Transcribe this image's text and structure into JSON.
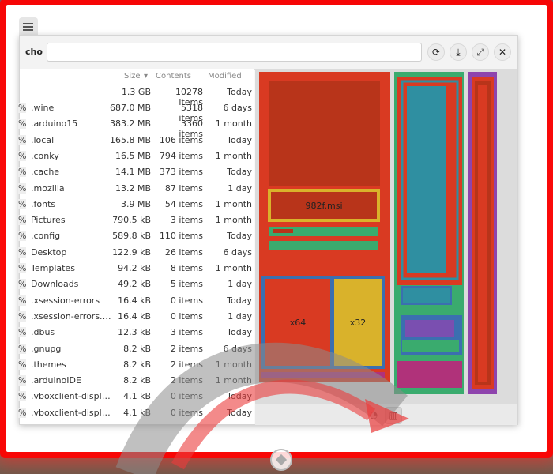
{
  "toolbar": {
    "path_label": "cho",
    "path_value": "",
    "icons": [
      "refresh-icon",
      "download-icon",
      "maximize-icon",
      "close-icon"
    ]
  },
  "columns": {
    "size": "Size",
    "contents": "Contents",
    "modified": "Modified"
  },
  "total": {
    "size": "1.3 GB",
    "items": "10278 items",
    "modified": "Today"
  },
  "rows": [
    {
      "pct": "%",
      "name": ".wine",
      "size": "687.0 MB",
      "items": "5318 items",
      "modified": "6 days"
    },
    {
      "pct": "%",
      "name": ".arduino15",
      "size": "383.2 MB",
      "items": "3360 items",
      "modified": "1 month"
    },
    {
      "pct": "%",
      "name": ".local",
      "size": "165.8 MB",
      "items": "106 items",
      "modified": "Today"
    },
    {
      "pct": "%",
      "name": ".conky",
      "size": "16.5 MB",
      "items": "794 items",
      "modified": "1 month"
    },
    {
      "pct": "%",
      "name": ".cache",
      "size": "14.1 MB",
      "items": "373 items",
      "modified": "Today"
    },
    {
      "pct": "%",
      "name": ".mozilla",
      "size": "13.2 MB",
      "items": "87 items",
      "modified": "1 day"
    },
    {
      "pct": "%",
      "name": ".fonts",
      "size": "3.9 MB",
      "items": "54 items",
      "modified": "1 month"
    },
    {
      "pct": "%",
      "name": "Pictures",
      "size": "790.5 kB",
      "items": "3 items",
      "modified": "1 month"
    },
    {
      "pct": "%",
      "name": ".config",
      "size": "589.8 kB",
      "items": "110 items",
      "modified": "Today"
    },
    {
      "pct": "%",
      "name": "Desktop",
      "size": "122.9 kB",
      "items": "26 items",
      "modified": "6 days"
    },
    {
      "pct": "%",
      "name": "Templates",
      "size": "94.2 kB",
      "items": "8 items",
      "modified": "1 month"
    },
    {
      "pct": "%",
      "name": "Downloads",
      "size": "49.2 kB",
      "items": "5 items",
      "modified": "1 day"
    },
    {
      "pct": "%",
      "name": ".xsession-errors",
      "size": "16.4 kB",
      "items": "0 items",
      "modified": "Today"
    },
    {
      "pct": "%",
      "name": ".xsession-errors.old",
      "size": "16.4 kB",
      "items": "0 items",
      "modified": "1 day"
    },
    {
      "pct": "%",
      "name": ".dbus",
      "size": "12.3 kB",
      "items": "3 items",
      "modified": "Today"
    },
    {
      "pct": "%",
      "name": ".gnupg",
      "size": "8.2 kB",
      "items": "2 items",
      "modified": "6 days"
    },
    {
      "pct": "%",
      "name": ".themes",
      "size": "8.2 kB",
      "items": "2 items",
      "modified": "1 month"
    },
    {
      "pct": "%",
      "name": ".arduinoIDE",
      "size": "8.2 kB",
      "items": "2 items",
      "modified": "1 month"
    },
    {
      "pct": "%",
      "name": ".vboxclient-display...",
      "size": "4.1 kB",
      "items": "0 items",
      "modified": "Today"
    },
    {
      "pct": "%",
      "name": ".vboxclient-display...",
      "size": "4.1 kB",
      "items": "0 items",
      "modified": "Today"
    }
  ],
  "treemap": {
    "labels": {
      "msi": "982f.msi",
      "x64": "x64",
      "x32": "x32"
    },
    "colors": {
      "red": "#d93a22",
      "darkred": "#b8341a",
      "yellow": "#d9b22b",
      "green": "#3aab6e",
      "teal": "#2f8fa1",
      "blue": "#3b6fb0",
      "purple": "#7a4fb0",
      "magenta": "#b0327a",
      "violet": "#8e44ad"
    }
  },
  "bottombar": {
    "icons": [
      "chart-ring-icon",
      "treemap-icon"
    ]
  }
}
